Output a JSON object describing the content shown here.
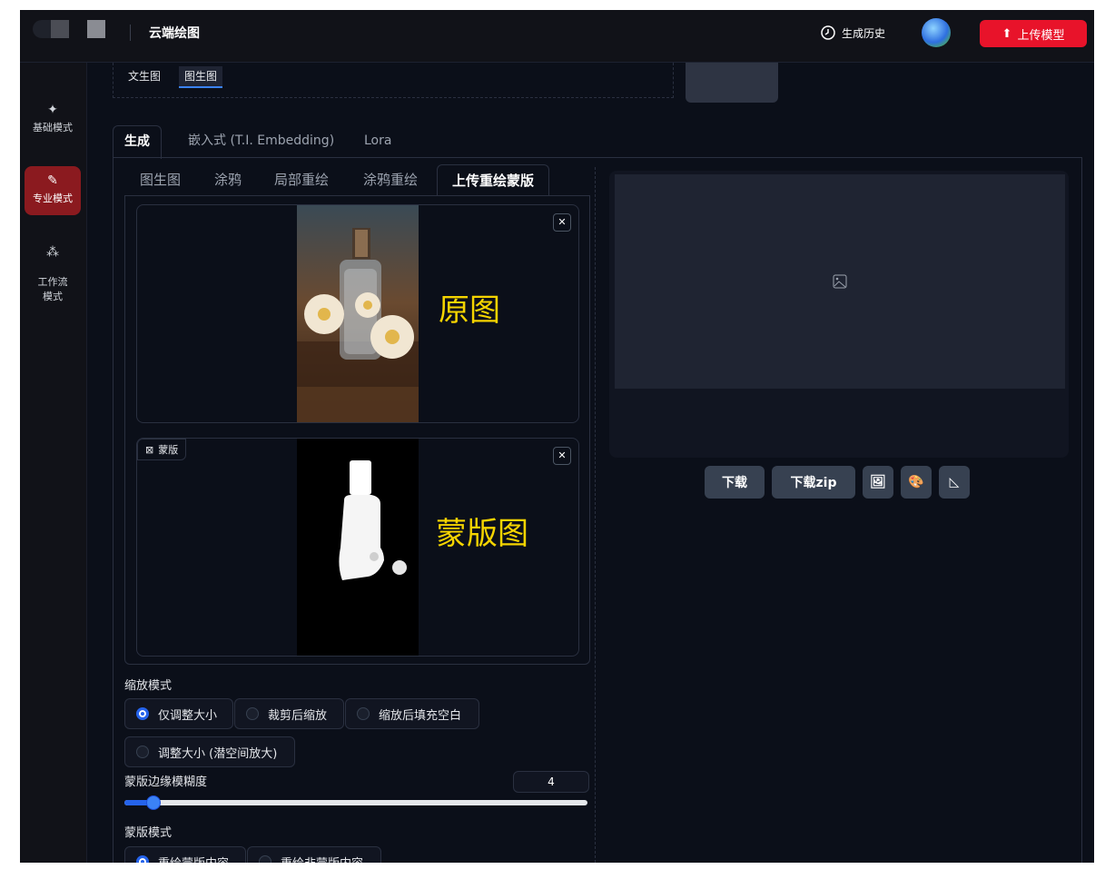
{
  "app": {
    "title": "云端绘图"
  },
  "topbar": {
    "history_label": "生成历史",
    "upload_label": "上传模型",
    "accent": "#e8132a"
  },
  "sidebar": {
    "items": [
      {
        "label": "基础模式",
        "icon": "sparkle-icon"
      },
      {
        "label": "专业模式",
        "icon": "brush-icon",
        "active": true
      },
      {
        "label": "工作流\n模式",
        "icon": "workflow-icon"
      }
    ]
  },
  "subtabs": [
    "文生图",
    "图生图"
  ],
  "main_tabs": [
    "生成",
    "嵌入式 (T.I. Embedding)",
    "Lora"
  ],
  "img_tabs": [
    "图生图",
    "涂鸦",
    "局部重绘",
    "涂鸦重绘",
    "上传重绘蒙版"
  ],
  "original": {
    "label": "原图"
  },
  "mask": {
    "tag": "蒙版",
    "label": "蒙版图"
  },
  "resize": {
    "label": "缩放模式",
    "options": [
      "仅调整大小",
      "裁剪后缩放",
      "缩放后填充空白",
      "调整大小 (潜空间放大)"
    ],
    "selected": 0
  },
  "blur": {
    "label": "蒙版边缘模糊度",
    "value": "4",
    "fraction": 0.06
  },
  "mask_mode": {
    "label": "蒙版模式",
    "options": [
      "重绘蒙版内容",
      "重绘非蒙版内容"
    ],
    "selected": 0
  },
  "output": {
    "buttons": [
      "下载",
      "下载zip"
    ],
    "icon_buttons": [
      "image-icon",
      "palette-icon",
      "ruler-icon"
    ]
  }
}
